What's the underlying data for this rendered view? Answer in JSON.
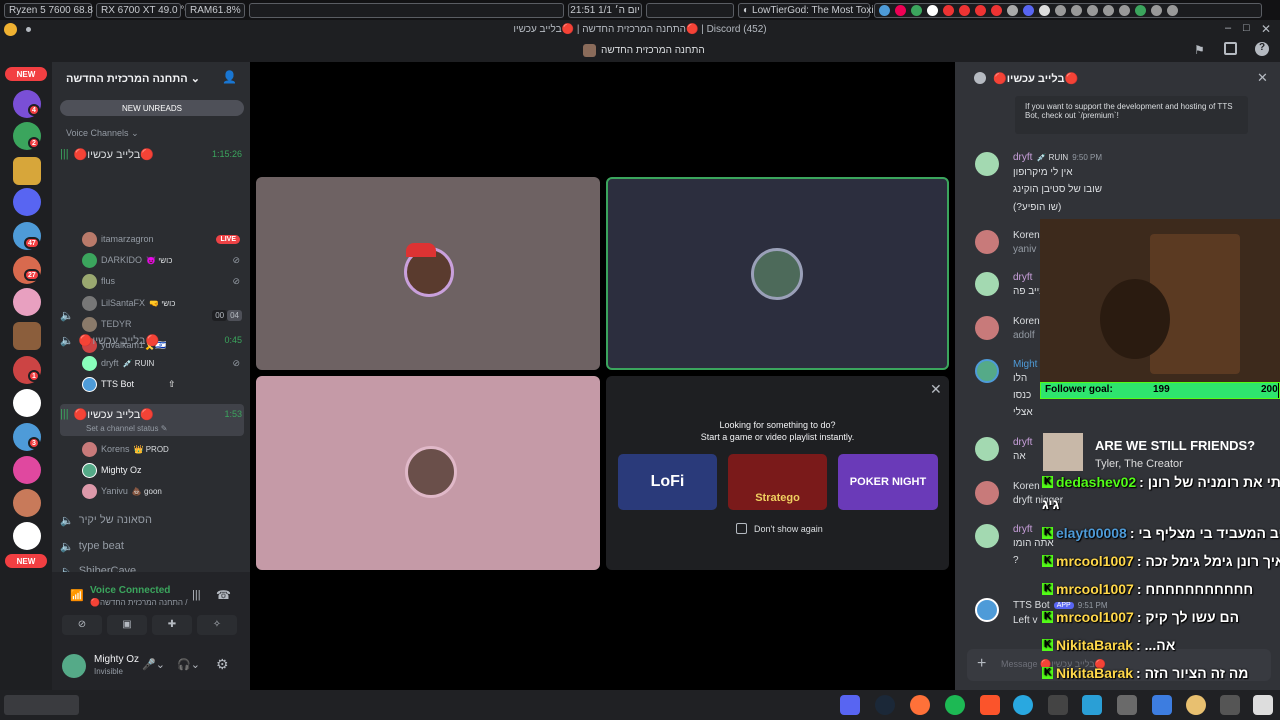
{
  "system_bar": {
    "cpu": "Ryzen 5 7600   68.8 °C",
    "gpu": "RX 6700 XT  49.0 °C",
    "ram_label": "RAM",
    "ram_value": "61.8%",
    "clock": "21:51  יום ה׳  1/1",
    "media": "LowTierGod: The Most Toxi..."
  },
  "title_bar": {
    "title": "התחנה המרכזית החדשה | 🔴בלייב עכשיו🔴 | Discord (452)"
  },
  "sub_bar": {
    "server_name": "התחנה המרכזית החדשה"
  },
  "rail": {
    "new_top": "NEW",
    "new_bottom": "NEW",
    "badges": [
      "4",
      "2",
      "47",
      "27",
      "1",
      "3"
    ],
    "colors": [
      "#7a4fd6",
      "#3ba55d",
      "#d7a63a",
      "#5865f2",
      "#4e9bd8",
      "#d86a4e",
      "#e8a0c0",
      "#8b5e3c",
      "#c44",
      "#ffffff",
      "#4e9bd8",
      "#e0489f",
      "#c87a5a",
      "#ffffff"
    ]
  },
  "sidebar": {
    "server_title": "התחנה המרכזית החדשה",
    "new_unreads": "NEW UNREADS",
    "voice_channels": "Voice Channels",
    "channels": [
      {
        "name": "🔴בלייב עכשיו🔴",
        "timer": "1:15:26"
      },
      {
        "name": "🔴בלייב עכשיו🔴",
        "timer": "0:45"
      },
      {
        "name": "🔴בלייב עכשיו🔴",
        "timer": "1:53",
        "status": "Set a channel status"
      }
    ],
    "vc1_users": [
      {
        "name": "itamarzagron",
        "live": "LIVE",
        "color": "#b97a6a"
      },
      {
        "name": "DARKIDO",
        "tag": "😈 כושי",
        "color": "#3ba55d"
      },
      {
        "name": "flus",
        "color": "#9aa870"
      },
      {
        "name": "LilSantaFX",
        "tag": "🤜 כושי",
        "color": "#777"
      },
      {
        "name": "TEDYR",
        "color": "#8a7a6a"
      },
      {
        "name": "yuvalkam1🎗️🇮🇱",
        "color": "#c44"
      }
    ],
    "empty_channel": {
      "name": "",
      "counts": [
        "00",
        "04"
      ]
    },
    "vc2_users": [
      {
        "name": "dryft",
        "tag": "💉 RUIN",
        "color": "#8fb"
      },
      {
        "name": "TTS Bot",
        "color": "#4e9bd8"
      }
    ],
    "vc3_users": [
      {
        "name": "Korens",
        "tag": "👑 PROD",
        "color": "#c87a7a"
      },
      {
        "name": "Mighty Oz",
        "color": "#5a8"
      },
      {
        "name": "Yanivu",
        "tag": "💩 goon",
        "color": "#d9a"
      }
    ],
    "other_channels": [
      "הסאונה של יקיר",
      "type beat",
      "ShiberCave"
    ],
    "voice_connected": "Voice Connected",
    "voice_location": "🔴בלייב עכשיו🔴 / התחנה המרכזית החדשה",
    "username": "Mighty Oz",
    "user_status": "Invisible"
  },
  "stage": {
    "activity_title": "Looking for something to do?",
    "activity_subtitle": "Start a game or video playlist instantly.",
    "activities": [
      "LoFi",
      "Stratego",
      "POKER NIGHT"
    ],
    "dont_show": "Don't show again"
  },
  "chat": {
    "channel_title": "🔴בלייב עכשיו🔴",
    "premium_text": "If you want to support the development and hosting of TTS Bot, check out `/premium`!",
    "messages": [
      {
        "author": "dryft",
        "tag": "💉 RUIN",
        "time": "9:50 PM",
        "color": "#a3d9b1",
        "lines": [
          "אין לי מיקרופון",
          "שובו של סטיבן הוקינג",
          "(שו הופיע?)"
        ]
      },
      {
        "author": "Korens",
        "color": "#dbdee1",
        "lines": [
          "yaniv"
        ]
      },
      {
        "author": "dryft",
        "color": "#c9a0dc",
        "lines": [
          "בייב פה"
        ]
      },
      {
        "author": "Koren",
        "color": "#dbdee1",
        "lines": [
          "adolf"
        ]
      },
      {
        "author": "Might",
        "color": "#4e9bd8",
        "lines": [
          "הלו",
          "כנסו",
          "אצלי"
        ]
      },
      {
        "author": "dryft",
        "color": "#c9a0dc",
        "lines": [
          "אה"
        ]
      },
      {
        "author": "Koren",
        "color": "#dbdee1",
        "lines": [
          "dryft nigger"
        ]
      },
      {
        "author": "dryft",
        "color": "#c9a0dc",
        "lines": [
          "אתה הומו",
          "?"
        ]
      },
      {
        "author": "TTS Bot",
        "app": "APP",
        "time": "9:51 PM",
        "color": "#dbdee1",
        "lines": [
          "Left v"
        ]
      }
    ],
    "input_placeholder": "Message 🔴בלייב עכשיו🔴"
  },
  "overlay": {
    "follower_label": "Follower goal:",
    "follower_current": "199",
    "follower_target": "200",
    "follower_progress": 0.995,
    "song_title": "ARE WE STILL FRIENDS?",
    "song_artist": "Tyler, The Creator",
    "chat_lines": [
      {
        "user": "dedashev02",
        "text": ": עקפתי את רומניה של רונן",
        "color": "#53fc18"
      },
      {
        "user": "",
        "text": "גיג",
        "color": "#53fc18"
      },
      {
        "user": "elayt00008",
        "text": ": יניב המעביד בי מצליף בי",
        "color": "#4e9bd8"
      },
      {
        "user": "mrcool1007",
        "text": ": איך רונן גימל גימל זכה",
        "color": "#ffd84a"
      },
      {
        "user": "mrcool1007",
        "text": ": חחחחחחחחחחח",
        "color": "#ffd84a"
      },
      {
        "user": "mrcool1007",
        "text": ": הם עשו לך קיק",
        "color": "#ffd84a"
      },
      {
        "user": "NikitaBarak",
        "text": ": ...אה",
        "color": "#ffd84a"
      },
      {
        "user": "NikitaBarak",
        "text": ": מה זה הציור הזה",
        "color": "#ffd84a"
      }
    ]
  }
}
